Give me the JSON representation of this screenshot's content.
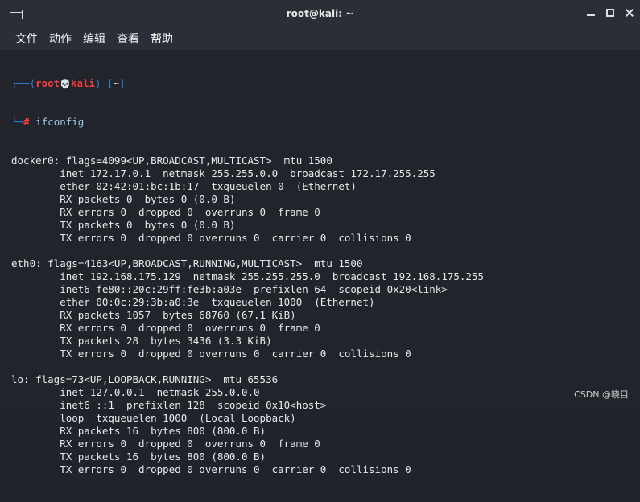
{
  "window": {
    "title": "root@kali: ~"
  },
  "menu": {
    "items": [
      "文件",
      "动作",
      "编辑",
      "查看",
      "帮助"
    ]
  },
  "prompt": {
    "line1_start": "┌──(",
    "user": "root",
    "skull": "💀",
    "host": "kali",
    "line1_mid": ")-[",
    "dir": "~",
    "line1_end": "]",
    "line2_start": "└─",
    "symbol": "#",
    "command": "ifconfig"
  },
  "output": [
    "docker0: flags=4099<UP,BROADCAST,MULTICAST>  mtu 1500",
    "        inet 172.17.0.1  netmask 255.255.0.0  broadcast 172.17.255.255",
    "        ether 02:42:01:bc:1b:17  txqueuelen 0  (Ethernet)",
    "        RX packets 0  bytes 0 (0.0 B)",
    "        RX errors 0  dropped 0  overruns 0  frame 0",
    "        TX packets 0  bytes 0 (0.0 B)",
    "        TX errors 0  dropped 0 overruns 0  carrier 0  collisions 0",
    "",
    "eth0: flags=4163<UP,BROADCAST,RUNNING,MULTICAST>  mtu 1500",
    "        inet 192.168.175.129  netmask 255.255.255.0  broadcast 192.168.175.255",
    "        inet6 fe80::20c:29ff:fe3b:a03e  prefixlen 64  scopeid 0x20<link>",
    "        ether 00:0c:29:3b:a0:3e  txqueuelen 1000  (Ethernet)",
    "        RX packets 1057  bytes 68760 (67.1 KiB)",
    "        RX errors 0  dropped 0  overruns 0  frame 0",
    "        TX packets 28  bytes 3436 (3.3 KiB)",
    "        TX errors 0  dropped 0 overruns 0  carrier 0  collisions 0",
    "",
    "lo: flags=73<UP,LOOPBACK,RUNNING>  mtu 65536",
    "        inet 127.0.0.1  netmask 255.0.0.0",
    "        inet6 ::1  prefixlen 128  scopeid 0x10<host>",
    "        loop  txqueuelen 1000  (Local Loopback)",
    "        RX packets 16  bytes 800 (800.0 B)",
    "        RX errors 0  dropped 0  overruns 0  frame 0",
    "        TX packets 16  bytes 800 (800.0 B)",
    "        TX errors 0  dropped 0 overruns 0  carrier 0  collisions 0"
  ],
  "watermark": "CSDN @晓目",
  "colors": {
    "background": "#21252b",
    "prompt_blue": "#2f7fd6",
    "prompt_red": "#ff3b3b",
    "text": "#e8e8e8"
  }
}
